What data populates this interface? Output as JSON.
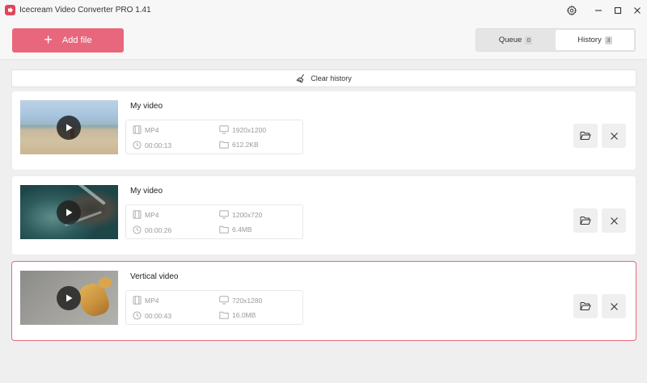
{
  "window": {
    "title": "Icecream Video Converter PRO 1.41"
  },
  "toolbar": {
    "add_file_label": "Add file",
    "tabs": [
      {
        "label": "Queue",
        "count": "0",
        "active": false
      },
      {
        "label": "History",
        "count": "3",
        "active": true
      }
    ]
  },
  "clear_history_label": "Clear history",
  "icons": {
    "app": "app-logo-icon",
    "settings": "gear-icon",
    "minimize": "minimize-icon",
    "maximize": "maximize-icon",
    "close": "close-icon",
    "add": "plus-icon",
    "clear": "broom-icon",
    "play": "play-icon",
    "format": "film-icon",
    "resolution": "monitor-icon",
    "duration": "clock-icon",
    "size": "folder-icon",
    "open_folder": "folder-open-icon",
    "remove": "close-icon"
  },
  "colors": {
    "accent": "#e8677d",
    "app_logo": "#e2445c",
    "background": "#efefef"
  },
  "videos": [
    {
      "name": "My video",
      "format": "MP4",
      "resolution": "1920x1200",
      "duration": "00:00:13",
      "size": "612.2KB",
      "selected": false
    },
    {
      "name": "My video",
      "format": "MP4",
      "resolution": "1200x720",
      "duration": "00:00:26",
      "size": "6.4MB",
      "selected": false
    },
    {
      "name": "Vertical video",
      "format": "MP4",
      "resolution": "720x1280",
      "duration": "00:00:43",
      "size": "16.0MB",
      "selected": true
    }
  ]
}
